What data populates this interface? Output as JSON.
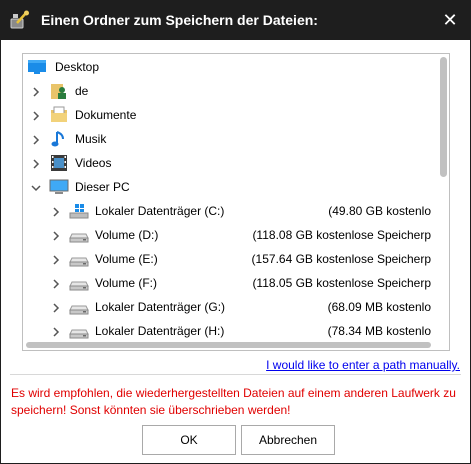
{
  "window": {
    "title": "Einen Ordner zum Speichern der Dateien:",
    "close_icon": "close-icon",
    "app_icon": "tool-icon",
    "colors": {
      "titlebar": "#1e1e1e",
      "warning_text": "#e00000",
      "link": "#0000ee"
    }
  },
  "tree": {
    "items": [
      {
        "label": "Desktop",
        "icon": "desktop-icon",
        "expander": "none",
        "space": ""
      },
      {
        "label": "de",
        "icon": "user-folder-icon",
        "expander": "collapsed",
        "space": ""
      },
      {
        "label": "Dokumente",
        "icon": "documents-icon",
        "expander": "collapsed",
        "space": ""
      },
      {
        "label": "Musik",
        "icon": "music-note-icon",
        "expander": "collapsed",
        "space": ""
      },
      {
        "label": "Videos",
        "icon": "film-strip-icon",
        "expander": "collapsed",
        "space": ""
      },
      {
        "label": "Dieser PC",
        "icon": "computer-icon",
        "expander": "expanded",
        "space": ""
      },
      {
        "label": "Lokaler Datenträger (C:)",
        "icon": "windows-drive-icon",
        "expander": "collapsed",
        "space": "(49.80 GB kostenlo"
      },
      {
        "label": "Volume (D:)",
        "icon": "drive-icon",
        "expander": "collapsed",
        "space": "(118.08 GB kostenlose Speicherp"
      },
      {
        "label": "Volume (E:)",
        "icon": "drive-icon",
        "expander": "collapsed",
        "space": "(157.64 GB kostenlose Speicherp"
      },
      {
        "label": "Volume (F:)",
        "icon": "drive-icon",
        "expander": "collapsed",
        "space": "(118.05 GB kostenlose Speicherp"
      },
      {
        "label": "Lokaler Datenträger (G:)",
        "icon": "drive-icon",
        "expander": "collapsed",
        "space": "(68.09 MB kostenlo"
      },
      {
        "label": "Lokaler Datenträger (H:)",
        "icon": "drive-icon",
        "expander": "collapsed",
        "space": "(78.34 MB kostenlo"
      }
    ]
  },
  "manual_path_link": "I would like to enter a path manually.",
  "warning_text": "Es wird empfohlen, die wiederhergestellten Dateien auf einem anderen Laufwerk zu speichern! Sonst könnten sie überschrieben werden!",
  "buttons": {
    "ok": "OK",
    "cancel": "Abbrechen"
  }
}
